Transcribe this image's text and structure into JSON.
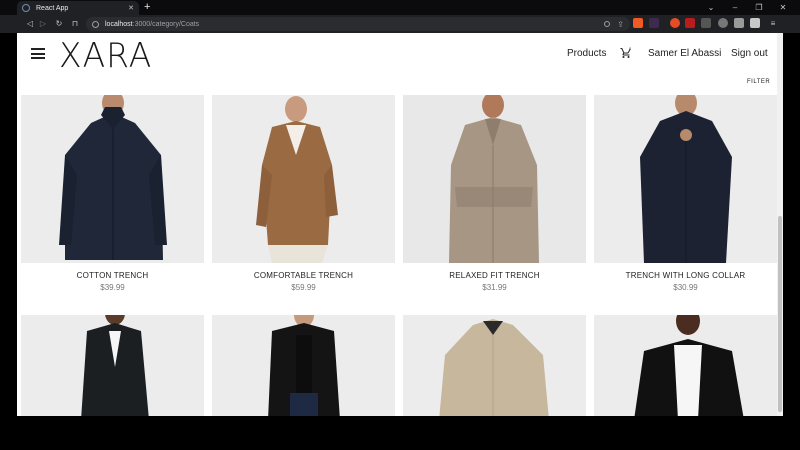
{
  "browser": {
    "tab_title": "React App",
    "url_host": "localhost",
    "url_path": ":3000/category/Coats"
  },
  "header": {
    "brand": "XARA",
    "products_label": "Products",
    "user_name": "Samer El Abassi",
    "signout_label": "Sign out",
    "cart_count": "0",
    "filter_label": "FILTER"
  },
  "products": [
    {
      "name": "COTTON TRENCH",
      "price": "$39.99",
      "coat_color": "#1f2738",
      "bg": "#ececec"
    },
    {
      "name": "COMFORTABLE TRENCH",
      "price": "$59.99",
      "coat_color": "#9a6a42",
      "bg": "#ececec"
    },
    {
      "name": "RELAXED FIT TRENCH",
      "price": "$31.99",
      "coat_color": "#a79684",
      "bg": "#e8e8e8"
    },
    {
      "name": "TRENCH WITH LONG COLLAR",
      "price": "$30.99",
      "coat_color": "#1d2233",
      "bg": "#ececec"
    },
    {
      "name": "",
      "price": "",
      "coat_color": "#1c1f22",
      "bg": "#ececec"
    },
    {
      "name": "",
      "price": "",
      "coat_color": "#141414",
      "bg": "#ececec"
    },
    {
      "name": "",
      "price": "",
      "coat_color": "#c7b79c",
      "bg": "#ececec"
    },
    {
      "name": "",
      "price": "",
      "coat_color": "#111111",
      "bg": "#ececec"
    }
  ]
}
